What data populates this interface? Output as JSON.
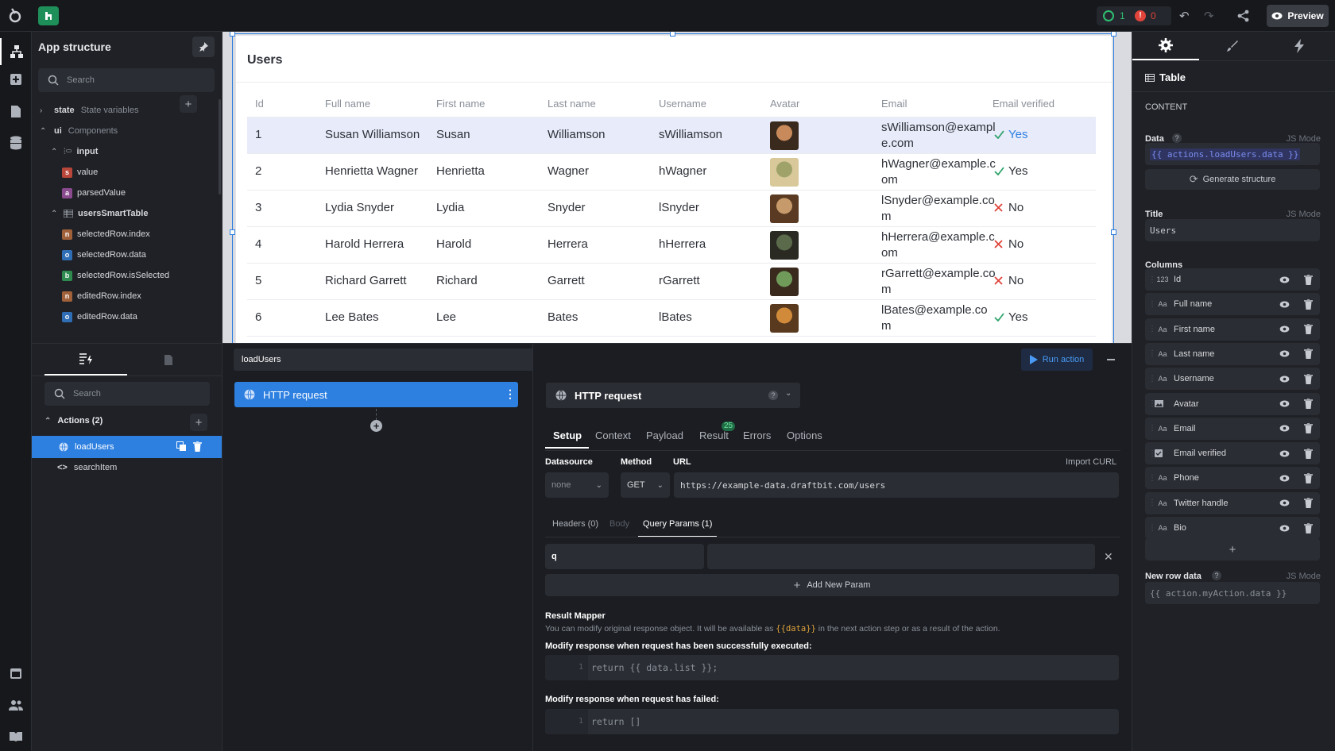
{
  "topbar": {
    "success_count": "1",
    "error_count": "0",
    "preview_label": "Preview"
  },
  "left": {
    "title": "App structure",
    "search_placeholder": "Search",
    "tree": [
      {
        "label": "state",
        "sub": "State variables"
      },
      {
        "label": "ui",
        "sub": "Components"
      },
      {
        "label": "input"
      },
      {
        "tag": "s",
        "label": "value"
      },
      {
        "tag": "a",
        "label": "parsedValue"
      },
      {
        "label": "usersSmartTable"
      },
      {
        "tag": "n",
        "label": "selectedRow.index"
      },
      {
        "tag": "o",
        "label": "selectedRow.data"
      },
      {
        "tag": "b",
        "label": "selectedRow.isSelected"
      },
      {
        "tag": "n",
        "label": "editedRow.index"
      },
      {
        "tag": "o",
        "label": "editedRow.data"
      }
    ]
  },
  "table": {
    "title": "Users",
    "headers": [
      "Id",
      "Full name",
      "First name",
      "Last name",
      "Username",
      "Avatar",
      "Email",
      "Email verified"
    ],
    "rows": [
      {
        "id": "1",
        "full": "Susan Williamson",
        "first": "Susan",
        "last": "Williamson",
        "user": "sWilliamson",
        "email": "sWilliamson@example.com",
        "verified": "Yes"
      },
      {
        "id": "2",
        "full": "Henrietta Wagner",
        "first": "Henrietta",
        "last": "Wagner",
        "user": "hWagner",
        "email": "hWagner@example.com",
        "verified": "Yes"
      },
      {
        "id": "3",
        "full": "Lydia Snyder",
        "first": "Lydia",
        "last": "Snyder",
        "user": "lSnyder",
        "email": "lSnyder@example.com",
        "verified": "No"
      },
      {
        "id": "4",
        "full": "Harold Herrera",
        "first": "Harold",
        "last": "Herrera",
        "user": "hHerrera",
        "email": "hHerrera@example.com",
        "verified": "No"
      },
      {
        "id": "5",
        "full": "Richard Garrett",
        "first": "Richard",
        "last": "Garrett",
        "user": "rGarrett",
        "email": "rGarrett@example.com",
        "verified": "No"
      },
      {
        "id": "6",
        "full": "Lee Bates",
        "first": "Lee",
        "last": "Bates",
        "user": "lBates",
        "email": "lBates@example.co m",
        "verified": "Yes"
      }
    ]
  },
  "right": {
    "component": "Table",
    "section": "CONTENT",
    "data_label": "Data",
    "js_mode": "JS Mode",
    "data_value": "{{ actions.loadUsers.data }}",
    "generate": "Generate structure",
    "title_label": "Title",
    "title_value": "Users",
    "columns_label": "Columns",
    "columns": [
      {
        "type": "123",
        "name": "Id"
      },
      {
        "type": "Aa",
        "name": "Full name"
      },
      {
        "type": "Aa",
        "name": "First name"
      },
      {
        "type": "Aa",
        "name": "Last name"
      },
      {
        "type": "Aa",
        "name": "Username"
      },
      {
        "type": "img",
        "name": "Avatar"
      },
      {
        "type": "Aa",
        "name": "Email"
      },
      {
        "type": "chk",
        "name": "Email verified"
      },
      {
        "type": "Aa",
        "name": "Phone"
      },
      {
        "type": "Aa",
        "name": "Twitter handle"
      },
      {
        "type": "Aa",
        "name": "Bio"
      }
    ],
    "new_row_label": "New row data",
    "new_row_value": "{{ action.myAction.data }}"
  },
  "actions": {
    "search_placeholder": "Search",
    "group_label": "Actions (2)",
    "items": [
      "loadUsers",
      "searchItem"
    ]
  },
  "flow": {
    "name": "loadUsers",
    "node": "HTTP request"
  },
  "editor": {
    "run_label": "Run action",
    "type": "HTTP request",
    "tabs": [
      "Setup",
      "Context",
      "Payload",
      "Result",
      "Errors",
      "Options"
    ],
    "result_badge": "25",
    "datasource_label": "Datasource",
    "method_label": "Method",
    "url_label": "URL",
    "import_curl": "Import CURL",
    "datasource": "none",
    "method": "GET",
    "url": "https://example-data.draftbit.com/users",
    "subtabs": [
      "Headers (0)",
      "Body",
      "Query Params (1)"
    ],
    "param_key": "q",
    "add_param": "Add New Param",
    "mapper_title": "Result Mapper",
    "mapper_desc_a": "You can modify original response object. It will be available as",
    "mapper_desc_code": "{{data}}",
    "mapper_desc_b": "in the next action step or as a result of the action.",
    "success_label": "Modify response when request has been successfully executed:",
    "success_code": "return {{ data.list }};",
    "fail_label": "Modify response when request has failed:",
    "fail_code": "return []",
    "line_no": "1"
  }
}
